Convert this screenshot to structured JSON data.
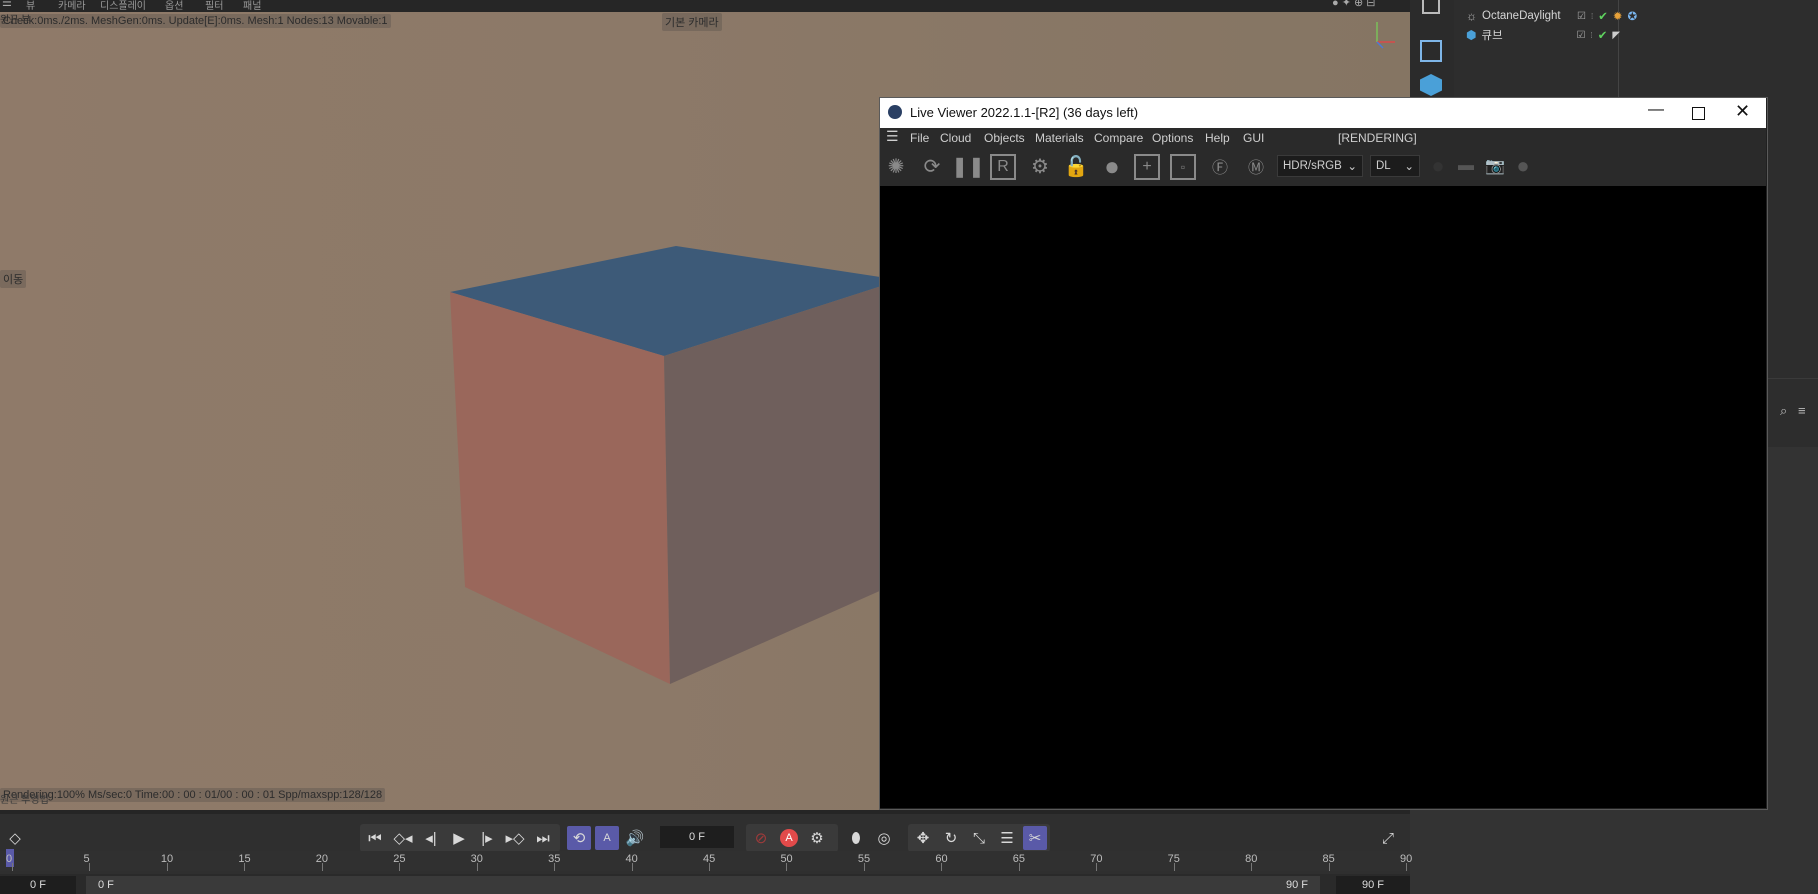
{
  "topmenu": {
    "items": [
      "뷰",
      "카메라",
      "디스플레이",
      "옵션",
      "필터",
      "패널"
    ]
  },
  "viewport": {
    "view_label": "원근 뷰",
    "stats_text": "Check:0ms./2ms. MeshGen:0ms. Update[E]:0ms. Mesh:1 Nodes:13 Movable:1",
    "camera_label": "기본 카메라",
    "move_label": "이동",
    "render_info": "Rendering:100% Ms/sec:0 Time:00 : 00 : 01/00 : 00 : 01 Spp/maxspp:128/128",
    "projection_label": "원근 투영법"
  },
  "objects": [
    {
      "name": "OctaneDaylight",
      "icon": "daylight-icon"
    },
    {
      "name": "큐브",
      "icon": "cube-icon"
    }
  ],
  "live_viewer": {
    "title": "Live Viewer 2022.1.1-[R2] (36 days left)",
    "menu": [
      "File",
      "Cloud",
      "Objects",
      "Materials",
      "Compare",
      "Options",
      "Help",
      "GUI"
    ],
    "status": "[RENDERING]",
    "colorspace": "HDR/sRGB",
    "kernel": "DL"
  },
  "timeline": {
    "current_frame": "0 F",
    "start_frame": "0 F",
    "range_start": "0 F",
    "range_end": "90 F",
    "end_frame": "90 F",
    "ticks": [
      "0",
      "5",
      "10",
      "15",
      "20",
      "25",
      "30",
      "35",
      "40",
      "45",
      "50",
      "55",
      "60",
      "65",
      "70",
      "75",
      "80",
      "85",
      "90"
    ]
  },
  "colors": {
    "accent": "#5a5aa8",
    "record": "#e24a4a",
    "cube_top": "#3d5a78",
    "cube_front": "#9a675b",
    "cube_side": "#6f5f5c"
  }
}
